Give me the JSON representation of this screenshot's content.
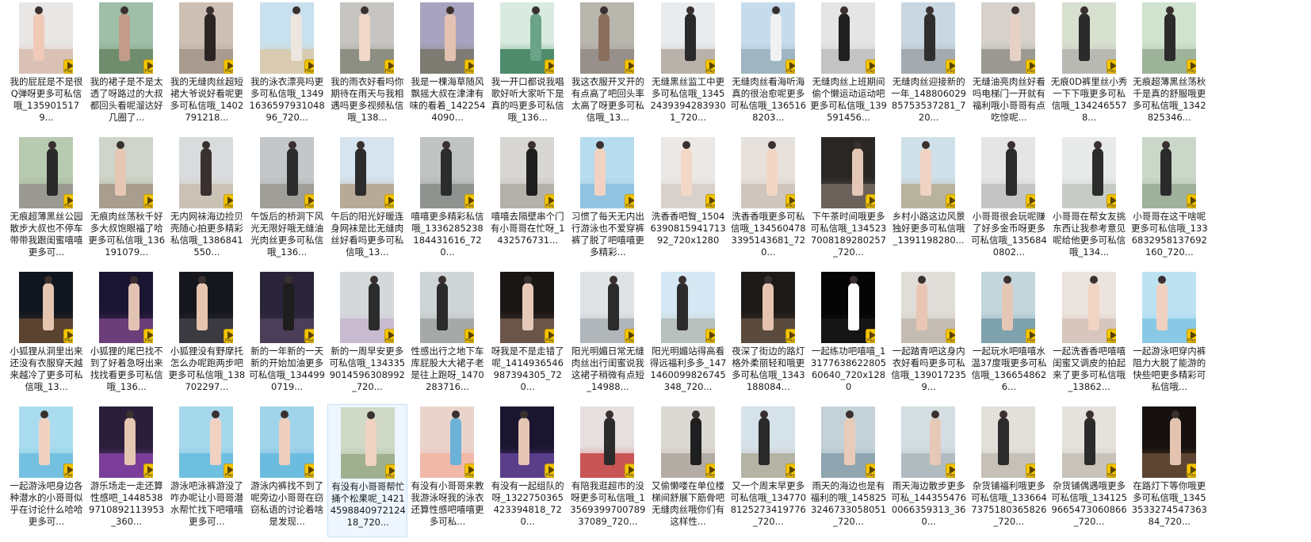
{
  "badge_label": "Player",
  "colors": {
    "badge": "#f2c300",
    "selection_bg": "#eef6ff",
    "selection_border": "#c9e0f7",
    "text": "#1a1a1a"
  },
  "selected_index": 49,
  "files": [
    {
      "name": "我的屁屁是不是很Q弹呀更多可私信哦_1359015179...",
      "thumb": [
        "#e9e6e6",
        "#d9c1b5",
        "#f0c9b7"
      ]
    },
    {
      "name": "我的裙子是不是太透了呀路过的大叔都回头看呢溜达好几圈了...",
      "thumb": [
        "#9fbfa9",
        "#6f8c6c",
        "#c29b8a"
      ]
    },
    {
      "name": "我的无缝肉丝超短裙大爷说好看呢更多可私信哦_1402791218...",
      "thumb": [
        "#cdbfb3",
        "#a99b8f",
        "#2b2525"
      ]
    },
    {
      "name": "我的泳衣漂亮吗更多可私信哦_1349163659793104896_720...",
      "thumb": [
        "#c9e0ee",
        "#d8cbb0",
        "#ede6df"
      ]
    },
    {
      "name": "我的雨衣好看吗你期待在雨天与我相遇吗更多视频私信哦_138...",
      "thumb": [
        "#c7c5c2",
        "#8c8f82",
        "#f1d9c9"
      ]
    },
    {
      "name": "我是一棵海草随风飘摇大叔在津津有味的看着_1422544090...",
      "thumb": [
        "#a8a4c0",
        "#7d7b72",
        "#e3c2b1"
      ]
    },
    {
      "name": "我一开口都说我唱歌好听大家听下是真的吗更多可私信哦_136...",
      "thumb": [
        "#d9ebe0",
        "#4d8b6a",
        "#6aa388"
      ]
    },
    {
      "name": "我这衣服开叉开的有点高了吧回头率太高了呀更多可私信哦_13...",
      "thumb": [
        "#b9b6ae",
        "#97908a",
        "#8b6f5e"
      ]
    },
    {
      "name": "无缝黑丝监工中更多可私信哦_134524393942839301_720...",
      "thumb": [
        "#e9ecef",
        "#b9b2aa",
        "#2a2a2a"
      ]
    },
    {
      "name": "无缝肉丝看海听海真的很治愈呢更多可私信哦_1365168203...",
      "thumb": [
        "#c6dcec",
        "#9fb6c2",
        "#f1f1f1"
      ]
    },
    {
      "name": "无缝肉丝上班期间偷个懒运动运动吧更多可私信哦_139591456...",
      "thumb": [
        "#e5e5e5",
        "#c3c3c3",
        "#202020"
      ]
    },
    {
      "name": "无缝肉丝迎接新的一年_14880602985753537281_720...",
      "thumb": [
        "#c9d7e2",
        "#a4aab0",
        "#2f2f2f"
      ]
    },
    {
      "name": "无缝油亮肉丝好看吗电梯门一开就有福利哦小哥哥有点吃惊呢...",
      "thumb": [
        "#d6d1cb",
        "#9c9892",
        "#e6d1c6"
      ]
    },
    {
      "name": "无痕0D裤里丝小秀一下下哦更多可私信哦_1342465578...",
      "thumb": [
        "#d8e0d0",
        "#b9b9b3",
        "#2a2a2a"
      ]
    },
    {
      "name": "无痕超薄黑丝荡秋千是真的舒服哦更多可私信哦_1342825346...",
      "thumb": [
        "#cfe3cf",
        "#9db39a",
        "#2b2b2b"
      ]
    },
    {
      "name": "无痕超薄黑丝公园散步大叔也不停车带带我跟闺蜜嘻嘻更多可...",
      "thumb": [
        "#b7cbb0",
        "#9a9a93",
        "#2a2a2a"
      ]
    },
    {
      "name": "无痕肉丝荡秋千好多大叔饱眼福了哈更多可私信哦_136191079...",
      "thumb": [
        "#cfd5ca",
        "#a89d8f",
        "#e6c7b3"
      ]
    },
    {
      "name": "无内网袜海边捡贝壳随心拍更多精彩私信哦_1386841550...",
      "thumb": [
        "#d9dcdc",
        "#c9c2b5",
        "#3a3030"
      ]
    },
    {
      "name": "午饭后的桥洞下风光无限好哦无缝油光肉丝更多可私信哦_136...",
      "thumb": [
        "#c3c7c9",
        "#a09e98",
        "#2c2c2c"
      ]
    },
    {
      "name": "午后的阳光好暖连身网袜是比无缝肉丝好看吗更多可私信哦_13...",
      "thumb": [
        "#d5e4ef",
        "#b7aa97",
        "#2c2c2c"
      ]
    },
    {
      "name": "嘻嘻更多精彩私信哦_1336285238184431616_720...",
      "thumb": [
        "#bfc3c2",
        "#8f938f",
        "#2c2c2c"
      ]
    },
    {
      "name": "嘻嘻去隔壁串个门有小哥哥在忙呀_1432576731...",
      "thumb": [
        "#d8d6d3",
        "#b4b0aa",
        "#1e1e1e"
      ]
    },
    {
      "name": "习惯了每天无内出行游泳也不爱穿裤裤了脱了吧嘻嘻更多精彩...",
      "thumb": [
        "#b8dcef",
        "#90c4e0",
        "#f1d1c0"
      ]
    },
    {
      "name": "洗香香吧臀_1504639081594171392_720x1280",
      "thumb": [
        "#ece8e5",
        "#d8d0cb",
        "#f3d8c8"
      ]
    },
    {
      "name": "洗香香哦更多可私信哦_1345604783395143681_720...",
      "thumb": [
        "#e6e1dc",
        "#cfc6bd",
        "#f2d6c4"
      ]
    },
    {
      "name": "下午茶时间哦更多可私信哦_1345237008189280257_720...",
      "thumb": [
        "#2a2623",
        "#6b625b",
        "#e5c7b7"
      ]
    },
    {
      "name": "乡村小路这边风景独好更多可私信哦_1391198280...",
      "thumb": [
        "#cfe0ea",
        "#b8b39d",
        "#f0d3c3"
      ]
    },
    {
      "name": "小哥哥很会玩呢赚了好多金币呀更多可私信哦_1356840802...",
      "thumb": [
        "#e5e5e5",
        "#c4c4c4",
        "#2b2b2b"
      ]
    },
    {
      "name": "小哥哥在帮女友挑东西让我参考意见呢给他更多可私信哦_134...",
      "thumb": [
        "#e7eae8",
        "#c7cbc6",
        "#2c2c2c"
      ]
    },
    {
      "name": "小哥哥在这干啥呢更多可私信哦_1336832958137692160_720...",
      "thumb": [
        "#cbd8c9",
        "#9fb19a",
        "#2b2b2b"
      ]
    },
    {
      "name": "小狐狸从洞里出来还没有衣服穿天越来越冷了更多可私信哦_13...",
      "thumb": [
        "#101520",
        "#5a4330",
        "#e5c5b0"
      ]
    },
    {
      "name": "小狐狸的尾巴找不到了好着急呀出来找找看更多可私信哦_136...",
      "thumb": [
        "#1a1530",
        "#6b3e7a",
        "#e2c3b3"
      ]
    },
    {
      "name": "小狐狸没有野摩托怎么办呢跑两步吧更多可私信哦_138702297...",
      "thumb": [
        "#15171c",
        "#3a3a40",
        "#e5c5b0"
      ]
    },
    {
      "name": "新的一年新的一天新的开始加油更多可私信哦_1344990719...",
      "thumb": [
        "#2a2438",
        "#4a3e58",
        "#1e1e1e"
      ]
    },
    {
      "name": "新的一周早安更多可私信哦_1343359014596308992_720...",
      "thumb": [
        "#d5d8da",
        "#c9bbcf",
        "#2c2c2c"
      ]
    },
    {
      "name": "性感出行之地下车库屁股大大裙子老是往上跑呀_1470283716...",
      "thumb": [
        "#cfd4d6",
        "#a5a9a8",
        "#2b2b2b"
      ]
    },
    {
      "name": "呀我是不是走错了呢_1414936546987394305_720...",
      "thumb": [
        "#1a1616",
        "#6b5448",
        "#e6c9b8"
      ]
    },
    {
      "name": "阳光明媚日常无缝肉丝出行闺蜜说我这裙子稍微有点短_14988...",
      "thumb": [
        "#dfe3e6",
        "#b1b6ba",
        "#2b2b2b"
      ]
    },
    {
      "name": "阳光明媚站得高看得远福利多多_1471460099826745348_720...",
      "thumb": [
        "#d5e8f3",
        "#b8c1bd",
        "#2b2b2b"
      ]
    },
    {
      "name": "夜深了街边的路灯格外柔丽轻和哦更多可私信哦_1343188084...",
      "thumb": [
        "#1e1a18",
        "#5a4b3e",
        "#e4c4b0"
      ]
    },
    {
      "name": "一起练功吧嘻嘻_1317763862280560640_720x1280",
      "thumb": [
        "#050505",
        "#151515",
        "#ffffff"
      ]
    },
    {
      "name": "一起踏青吧这身内衣好看吗更多可私信哦_1390172359...",
      "thumb": [
        "#e0ddd8",
        "#c4bcb2",
        "#e8c6b3"
      ]
    },
    {
      "name": "一起玩水吧嘻嘻水温37度哦更多可私信哦_1366548626...",
      "thumb": [
        "#c3d6dc",
        "#7da1ad",
        "#e6c7b5"
      ]
    },
    {
      "name": "一起洗香香吧嘻嘻闺蜜又调皮的拍起来了更多可私信哦_13862...",
      "thumb": [
        "#ebe3de",
        "#d7c6bd",
        "#f2d4c3"
      ]
    },
    {
      "name": "一起游泳吧穿内裤阻力大脱了能游的快些吧更多精彩可私信哦...",
      "thumb": [
        "#bde3f3",
        "#8ac9e6",
        "#f0d0c0"
      ]
    },
    {
      "name": "一起游泳吧身边各种潜水的小哥哥似乎在讨论什么哈哈更多可...",
      "thumb": [
        "#a9dcee",
        "#74c0e0",
        "#f1d2c1"
      ]
    },
    {
      "name": "游乐场走一走还算性感吧_14485389710892113953_360...",
      "thumb": [
        "#2a1e3a",
        "#7a3e9a",
        "#e5c6b3"
      ]
    },
    {
      "name": "游泳吧泳裤游没了咋办呢让小哥哥潜水帮忙找下吧嘻嘻更多可...",
      "thumb": [
        "#a6d8ec",
        "#6fbfe0",
        "#f1d2c2"
      ]
    },
    {
      "name": "游泳内裤找不到了呢旁边小哥哥在窃窃私语的讨论着啥是发现...",
      "thumb": [
        "#9fd4ea",
        "#6cbce0",
        "#f0cfbe"
      ]
    },
    {
      "name": "有没有小哥哥帮忙捅个松果呢_1421459884097212418_720...",
      "thumb": [
        "#cfd9c6",
        "#9fb08f",
        "#f0d2c2"
      ]
    },
    {
      "name": "有没有小哥哥来教我游泳呀我的泳衣还算性感吧嘻嘻更多可私...",
      "thumb": [
        "#e9d4cc",
        "#f0b8a8",
        "#6cb2d8"
      ]
    },
    {
      "name": "有没有一起组队的呀_1322750365423394818_720...",
      "thumb": [
        "#1a1630",
        "#5a3e8a",
        "#e4c5b3"
      ]
    },
    {
      "name": "有陪我逛超市的没呀更多可私信哦_1356939970078937089_720...",
      "thumb": [
        "#e5dfdf",
        "#c95454",
        "#2b2b2b"
      ]
    },
    {
      "name": "又偷懒喽在单位楼梯间舒展下筋骨吧无缝肉丝哦你们有这样性...",
      "thumb": [
        "#dcd8d3",
        "#b3aca4",
        "#1f1f1f"
      ]
    },
    {
      "name": "又一个周末早更多可私信哦_1347708125273419776_720...",
      "thumb": [
        "#d6e2ea",
        "#b4b3a4",
        "#2a2a2a"
      ]
    },
    {
      "name": "雨天的海边也是有福利的哦_1458253246733058051_720...",
      "thumb": [
        "#c5d1d8",
        "#8fa5b0",
        "#e8cbb9"
      ]
    },
    {
      "name": "雨天海边散步更多可私_1443554760066359313_360...",
      "thumb": [
        "#d3dde2",
        "#b1bcc0",
        "#e6c8b7"
      ]
    },
    {
      "name": "杂货铺福利哦更多可私信哦_1336647375180365826_720...",
      "thumb": [
        "#e3e0da",
        "#c6c0b6",
        "#2b2b2b"
      ]
    },
    {
      "name": "杂货铺偶遇哦更多可私信哦_1341259665473060866_720...",
      "thumb": [
        "#e5e1dc",
        "#c8c2b9",
        "#2b2b2b"
      ]
    },
    {
      "name": "在路灯下等你哦更多可私信哦_1345353327454736384_720...",
      "thumb": [
        "#16110e",
        "#5c4532",
        "#e4c4b0"
      ]
    }
  ]
}
